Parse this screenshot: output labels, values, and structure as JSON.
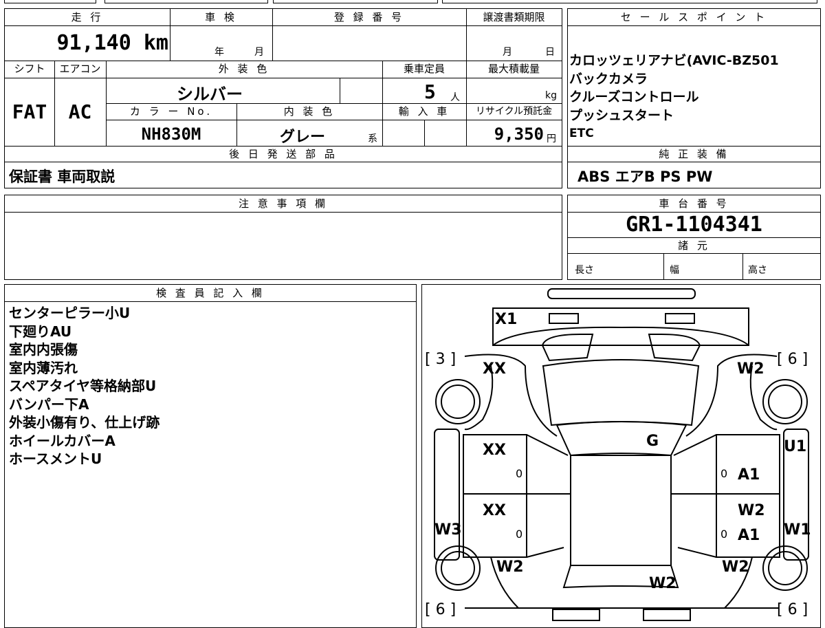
{
  "vehicle": {
    "labels": {
      "mileage": "走 行",
      "inspection": "車 検",
      "registration": "登 録 番 号",
      "transfer_deadline": "譲渡書類期限",
      "shift": "シフト",
      "ac": "エアコン",
      "exterior_color": "外 装 色",
      "capacity": "乗車定員",
      "max_load": "最大積載量",
      "color_no": "カ ラ ー No.",
      "interior_color": "内 装 色",
      "import": "輸 入 車",
      "recycle": "リサイクル預託金",
      "later_parts": "後 日 発 送 部 品"
    },
    "mileage": "91,140 km",
    "inspection_year_unit": "年",
    "inspection_month_unit": "月",
    "deadline_month_unit": "月",
    "deadline_day_unit": "日",
    "shift": "FAT",
    "ac": "AC",
    "exterior_color": "シルバー",
    "capacity": "5",
    "capacity_unit": "人",
    "max_load_unit": "kg",
    "color_no": "NH830M",
    "interior_color": "グレー",
    "interior_suffix": "系",
    "recycle_fee": "9,350",
    "recycle_unit": "円",
    "later_parts": "保証書 車両取説"
  },
  "sales_points": {
    "label": "セ ー ル ス ポ イ ン ト",
    "items": [
      "カロッツェリアナビ(AVIC-BZ501",
      "バックカメラ",
      "クルーズコントロール",
      "プッシュスタート",
      "ETC"
    ]
  },
  "standard_equipment": {
    "label": "純 正 装 備",
    "value": "ABS エアB PS PW"
  },
  "notes": {
    "label": "注 意 事 項 欄"
  },
  "chassis": {
    "label": "車 台 番 号",
    "value": "GR1-1104341",
    "spec_label": "諸 元",
    "length": "長さ",
    "width": "幅",
    "height": "高さ"
  },
  "inspector": {
    "label": "検 査 員 記 入 欄",
    "lines": [
      "センターピラー小U",
      "下廻りAU",
      "室内内張傷",
      "室内薄汚れ",
      "スペアタイヤ等格納部U",
      "バンパー下A",
      "外装小傷有り、仕上げ跡",
      "ホイールカバーA",
      "ホースメントU"
    ]
  },
  "diagram": {
    "marks": {
      "x1": "X1",
      "front_left": "XX",
      "front_right": "W2",
      "hood_center": "G",
      "rear_door_left": "XX",
      "rear_door_right": "A1",
      "rear_left_panel": "XX",
      "rear_right_panel": "W2",
      "rear_right_panel2": "A1",
      "left_side_w3": "W3",
      "right_side_u1": "U1",
      "right_side_w1": "W1",
      "rear_left_wheel": "W2",
      "rear_right_wheel": "W2",
      "rear_center": "W2",
      "zero1": "0",
      "zero2": "0",
      "zero3": "0",
      "zero4": "0"
    },
    "tires": {
      "fl": "[ 3 ]",
      "fr": "[ 6 ]",
      "rl": "[ 6 ]",
      "rr": "[ 6 ]"
    }
  }
}
